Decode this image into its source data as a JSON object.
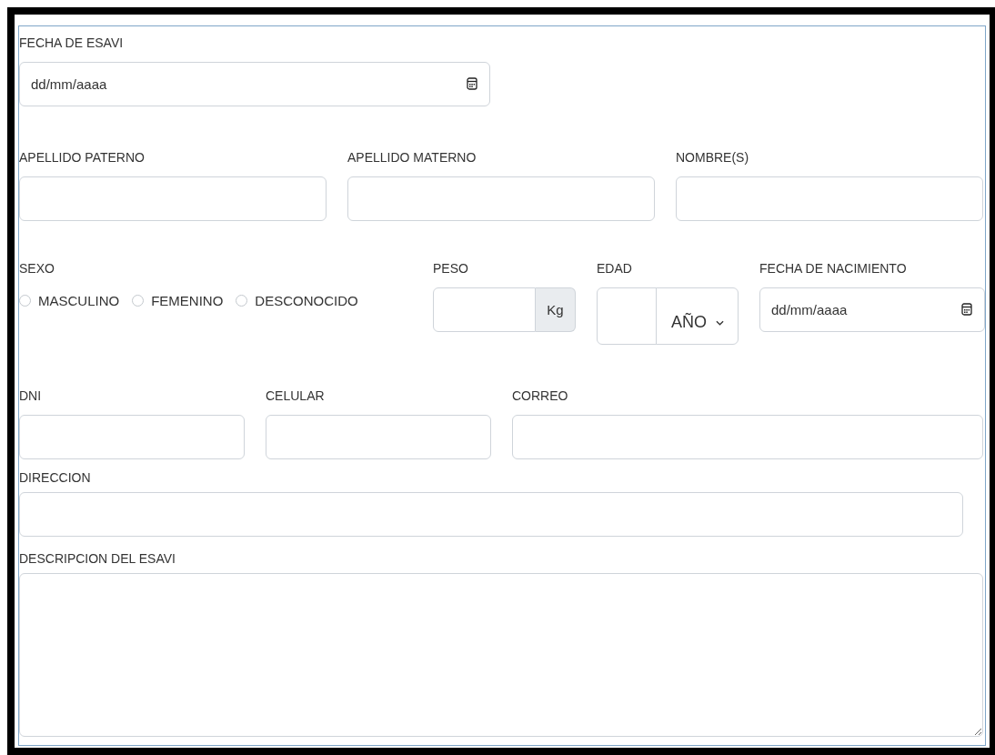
{
  "form": {
    "rows": [
      {
        "fields": [
          {
            "kind": "date",
            "label": "FECHA DE ESAVI",
            "placeholder": "dd/mm/aaaa"
          }
        ]
      },
      {
        "fields": [
          {
            "kind": "text",
            "label": "APELLIDO PATERNO"
          },
          {
            "kind": "text",
            "label": "APELLIDO MATERNO"
          },
          {
            "kind": "text",
            "label": "NOMBRE(S)"
          }
        ]
      },
      {
        "fields": [
          {
            "kind": "radio",
            "label": "SEXO",
            "options": [
              {
                "label": "MASCULINO",
                "selected": false
              },
              {
                "label": "FEMENINO",
                "selected": false
              },
              {
                "label": "DESCONOCIDO",
                "selected": false
              }
            ]
          },
          {
            "kind": "addon",
            "label": "PESO",
            "unit": "Kg"
          },
          {
            "kind": "age",
            "label": "EDAD",
            "unit": "AÑO"
          },
          {
            "kind": "date",
            "label": "FECHA DE NACIMIENTO",
            "placeholder": "dd/mm/aaaa"
          }
        ]
      },
      {
        "fields": [
          {
            "kind": "text",
            "label": "DNI"
          },
          {
            "kind": "text",
            "label": "CELULAR"
          },
          {
            "kind": "text",
            "label": "CORREO"
          }
        ]
      },
      {
        "fields": [
          {
            "kind": "text",
            "label": "DIRECCION"
          }
        ]
      },
      {
        "fields": [
          {
            "kind": "textarea",
            "label": "DESCRIPCION DEL ESAVI"
          }
        ]
      }
    ]
  }
}
